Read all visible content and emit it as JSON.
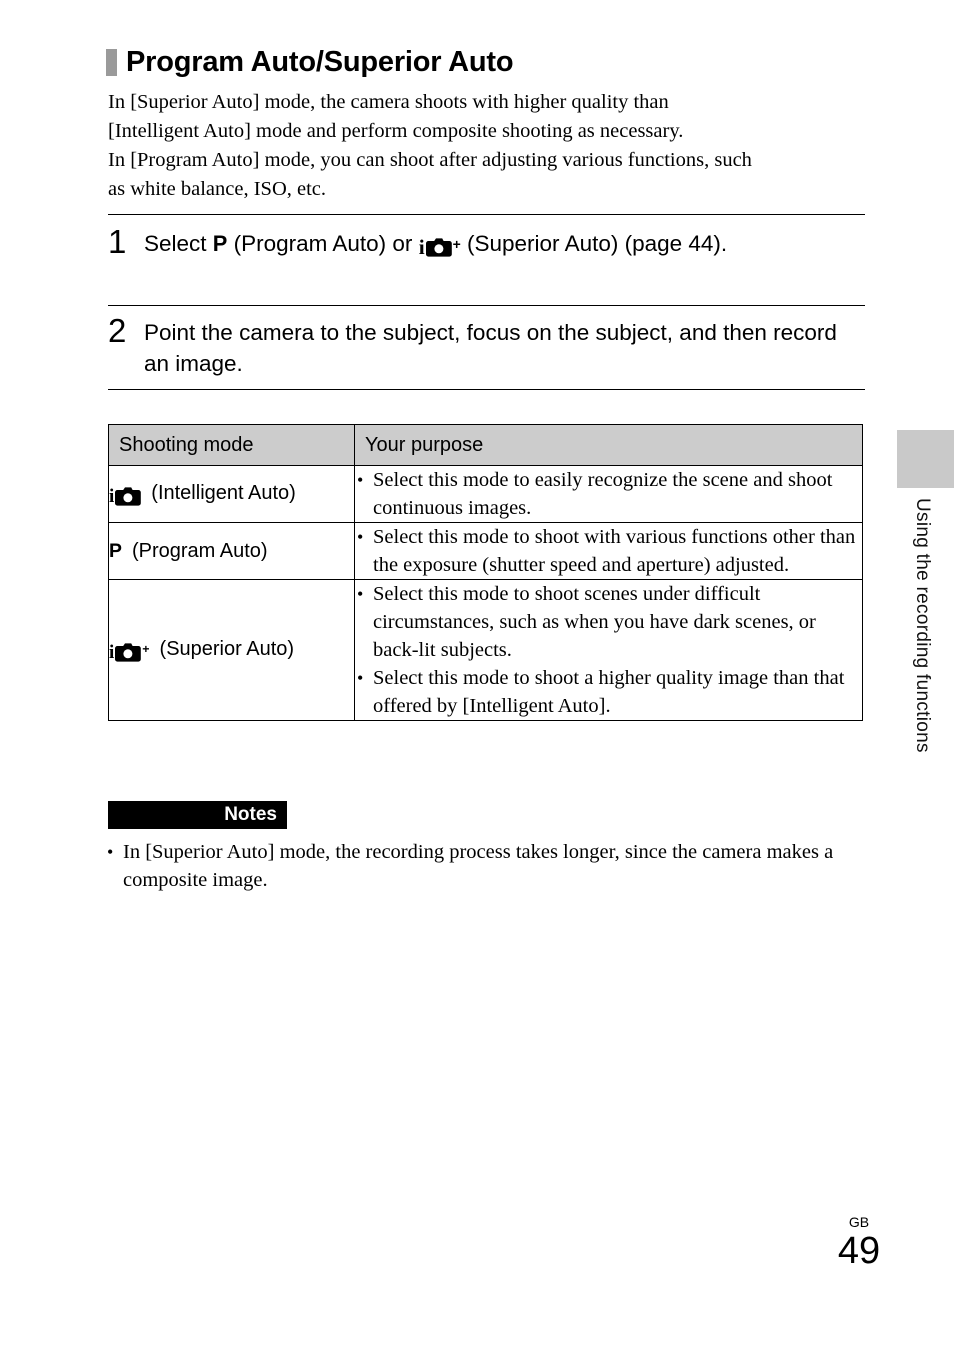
{
  "heading": {
    "title": "Program Auto/Superior Auto",
    "bar_color": "#9a9a9a"
  },
  "intro": {
    "line1": "In [Superior Auto] mode, the camera shoots with higher quality than",
    "line2": "[Intelligent Auto] mode and perform composite shooting as necessary.",
    "line3": "In [Program Auto] mode, you can shoot after adjusting various functions, such",
    "line4": "as white balance, ISO, etc."
  },
  "steps": [
    {
      "number": "1",
      "text_before_p": "Select ",
      "p_glyph": "P",
      "text_middle": " (Program Auto) or ",
      "i_glyph": "i",
      "plus_glyph": "+",
      "text_after": " (Superior Auto) (page 44)."
    },
    {
      "number": "2",
      "text": "Point the camera to the subject, focus on the subject, and then record an image."
    }
  ],
  "table": {
    "headers": [
      "Shooting mode",
      "Your purpose"
    ],
    "rows": [
      {
        "mode_icon": "intelligent-auto-icon",
        "i_glyph": "i",
        "plus_glyph": "",
        "p_glyph": "",
        "mode_label": "(Intelligent Auto)",
        "purposes": [
          "Select this mode to easily recognize the scene and shoot continuous images."
        ]
      },
      {
        "mode_icon": "program-auto-icon",
        "i_glyph": "",
        "plus_glyph": "",
        "p_glyph": "P",
        "mode_label": "(Program Auto)",
        "purposes": [
          "Select this mode to shoot with various functions other than the exposure (shutter speed and aperture) adjusted."
        ]
      },
      {
        "mode_icon": "superior-auto-icon",
        "i_glyph": "i",
        "plus_glyph": "+",
        "p_glyph": "",
        "mode_label": "(Superior Auto)",
        "purposes": [
          "Select this mode to shoot scenes under difficult circumstances, such as when you have dark scenes, or back-lit subjects.",
          "Select this mode to shoot a higher quality image than that offered by [Intelligent Auto]."
        ]
      }
    ],
    "header_background": "#cccccc"
  },
  "notes": {
    "label": "Notes",
    "items": [
      "In [Superior Auto] mode, the recording process takes longer, since the camera makes a composite image."
    ]
  },
  "sidebar": {
    "vertical_label": "Using the recording functions",
    "tab_color": "#c9c9c9"
  },
  "footer": {
    "region": "GB",
    "page_number": "49"
  }
}
